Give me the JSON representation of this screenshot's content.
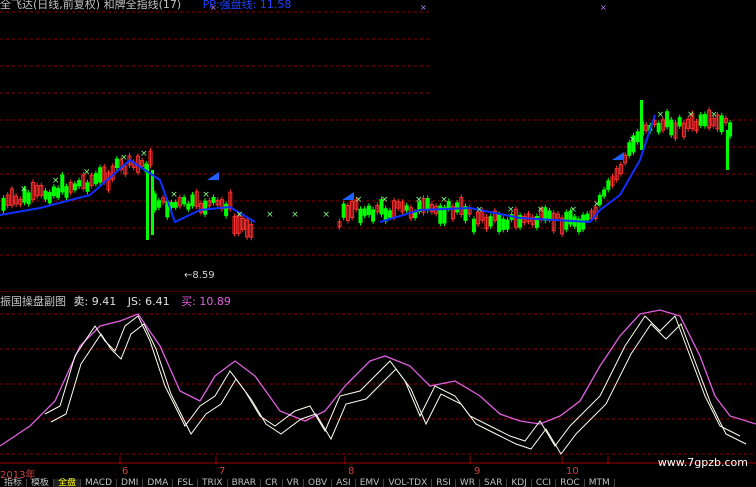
{
  "title_bar": {
    "title": "全飞达(日线,前复权) 和牌全指线(17)",
    "price_label": "PP:强盘线: 11.58"
  },
  "main_chart": {
    "low_price_label": "←8.59",
    "colors": {
      "up": "#ff3030",
      "down": "#00ff00",
      "ma": "#1030ff",
      "grid": "#8a0000",
      "marker": "#2060ff",
      "cross": "#c080ff"
    }
  },
  "sub_chart": {
    "name": "振国操盘副图",
    "sell_label": "卖: 9.41",
    "js_label": "JS: 6.41",
    "buy_label": "买: 10.89",
    "colors": {
      "buy": "#e060e0",
      "sell": "#fffff0",
      "js": "#fffff0"
    }
  },
  "date_axis": {
    "labels": [
      "2013年",
      "6",
      "7",
      "8",
      "9",
      "10"
    ]
  },
  "tabs": {
    "items": [
      "指标",
      "模板",
      "全盘",
      "MACD",
      "DMI",
      "DMA",
      "FSL",
      "TRIX",
      "BRAR",
      "CR",
      "VR",
      "OBV",
      "ASI",
      "EMV",
      "VOL-TDX",
      "RSI",
      "WR",
      "SAR",
      "KDJ",
      "CCI",
      "ROC",
      "MTM"
    ],
    "active_index": 2
  },
  "watermark": "www.7gpzb.com"
}
